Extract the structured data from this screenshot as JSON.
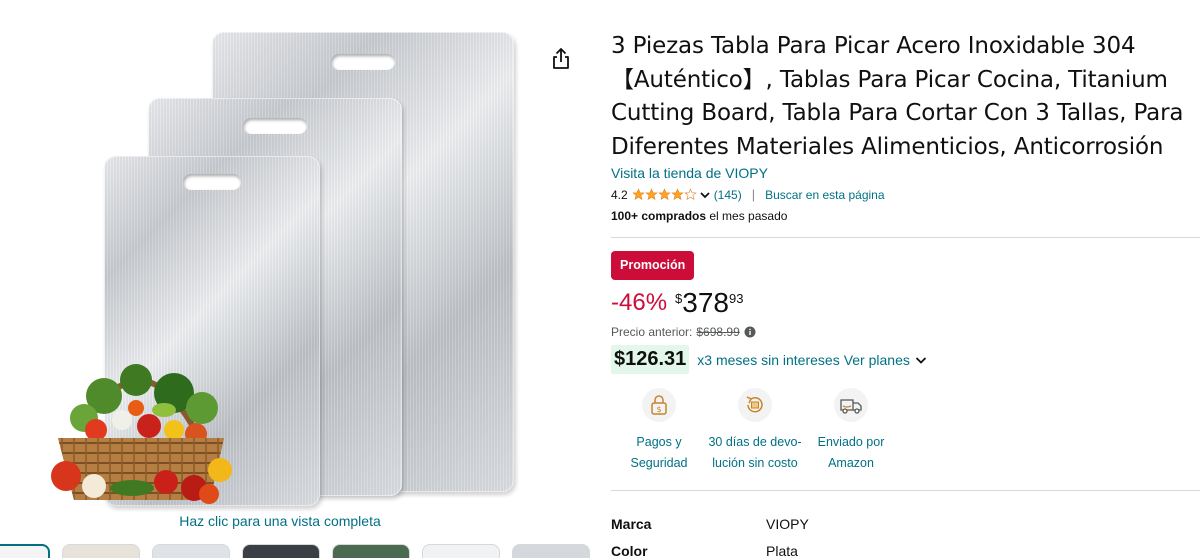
{
  "share_label": "Compartir",
  "gallery": {
    "zoom_hint": "Haz clic para una vista completa",
    "thumbnail_count": 7
  },
  "product": {
    "title": "3 Piezas Tabla Para Picar Acero Inoxidable 304 【Auténtico】, Tablas Para Picar Cocina, Titanium Cutting Board, Tabla Para Cortar Con 3 Tallas, Para Diferentes Materiales Alimenticios, Anticorrosión",
    "store_link": "Visita la tienda de VIOPY",
    "rating_value": "4.2",
    "rating_stars": 4.2,
    "rating_count": "(145)",
    "search_page": "Buscar en esta página",
    "bought_bold": "100+ comprados",
    "bought_rest": " el mes pasado"
  },
  "pricing": {
    "deal_badge": "Promoción",
    "discount": "-46%",
    "currency": "$",
    "price_whole": "378",
    "price_fraction": "93",
    "previous_label": "Precio anterior:",
    "previous_price": "$698.99",
    "installment_amount": "$126.31",
    "installment_text": "x3 meses sin intereses",
    "installment_link": "Ver planes"
  },
  "trust_badges": [
    {
      "icon": "secure-payment-icon",
      "line1": "Pagos y",
      "line2": "Seguridad"
    },
    {
      "icon": "return-icon",
      "line1": "30 días de devo-",
      "line2": "lución sin costo"
    },
    {
      "icon": "delivery-truck-icon",
      "line1": "Enviado por",
      "line2": "Amazon"
    }
  ],
  "specs": [
    {
      "key": "Marca",
      "value": "VIOPY"
    },
    {
      "key": "Color",
      "value": "Plata"
    }
  ],
  "colors": {
    "link": "#007185",
    "deal": "#cc0c39",
    "star": "#ffa41c",
    "installment_bg": "#e3f7ea"
  }
}
